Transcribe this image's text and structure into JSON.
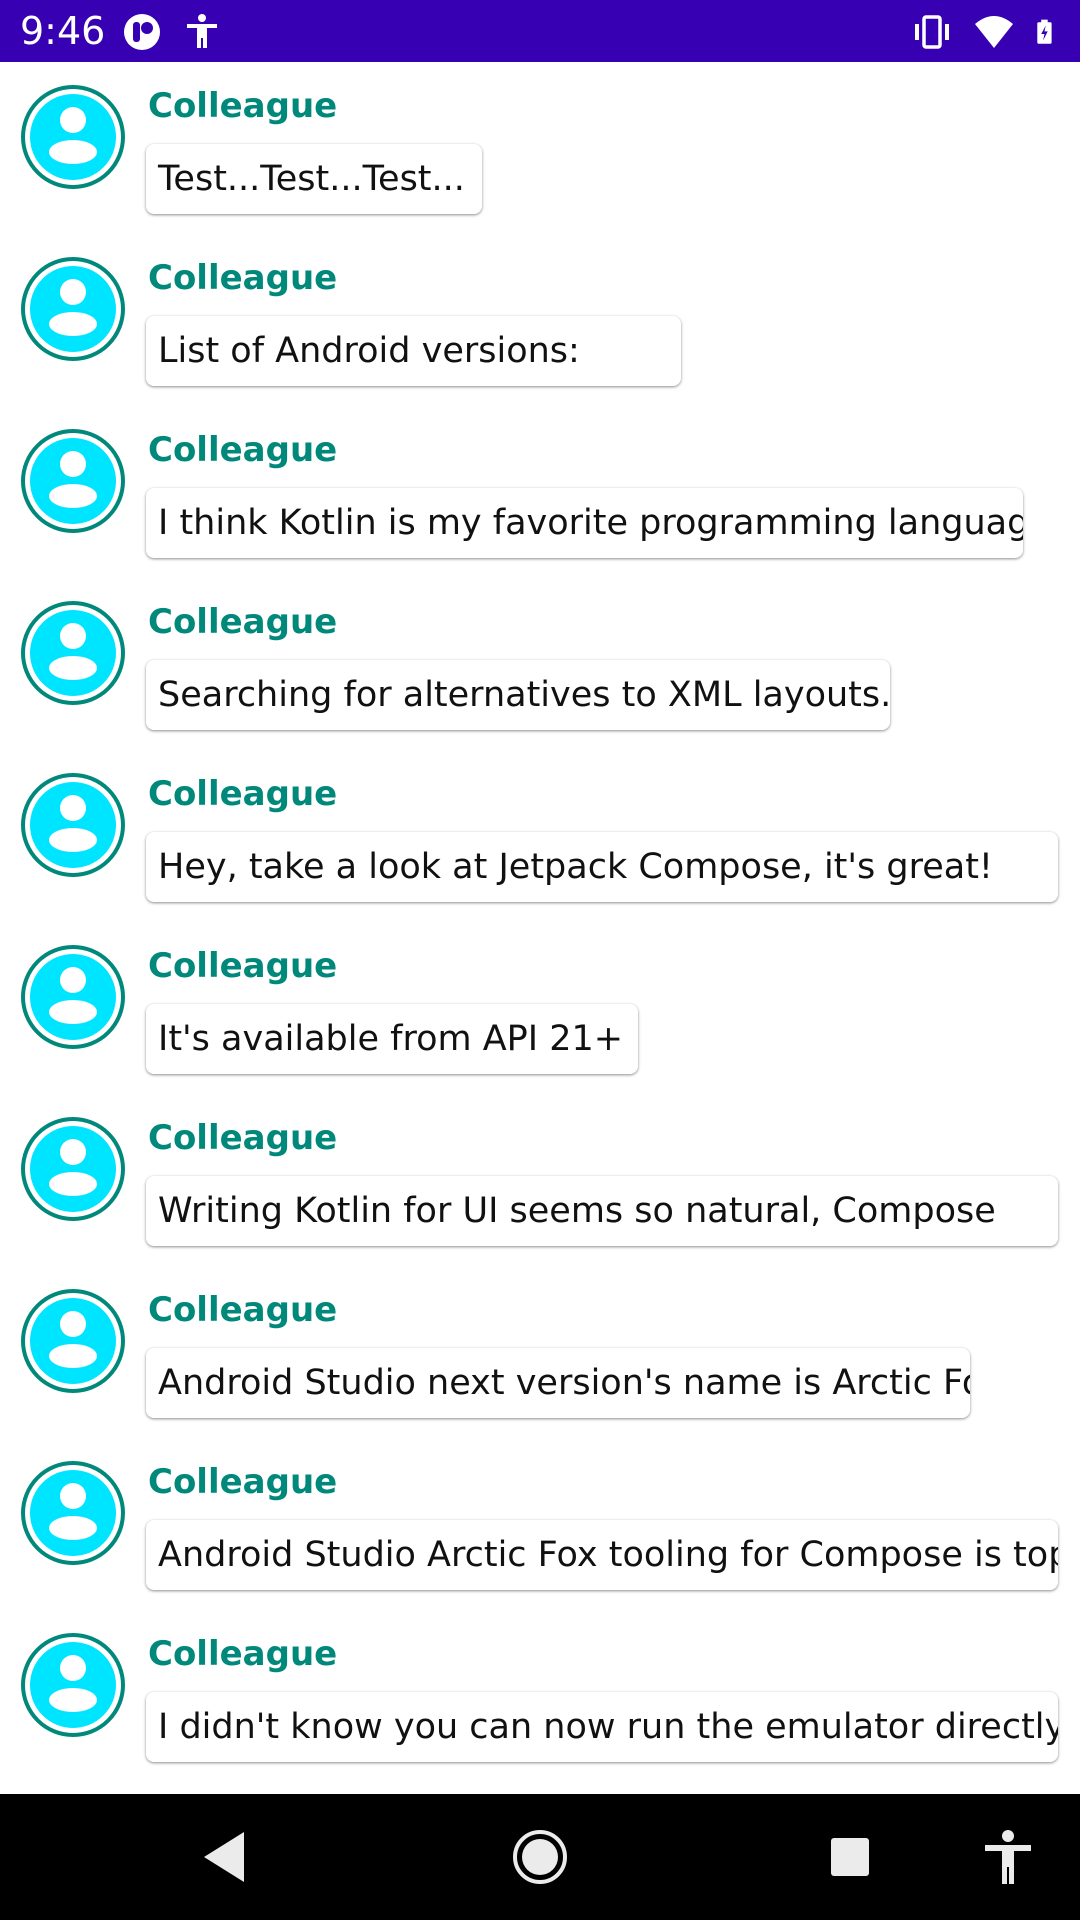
{
  "status_bar": {
    "time": "9:46",
    "left_icons": [
      "notification-app-icon",
      "accessibility-icon"
    ],
    "right_icons": [
      "vibrate-icon",
      "wifi-icon",
      "battery-charging-icon"
    ],
    "background": "#3700b3"
  },
  "colors": {
    "sender_name": "#00897b",
    "avatar": "#00e5ff",
    "avatar_ring": "#00897b"
  },
  "messages": [
    {
      "sender": "Colleague",
      "text": "Test...Test...Test..."
    },
    {
      "sender": "Colleague",
      "text": "List of Android versions:"
    },
    {
      "sender": "Colleague",
      "text": "I think Kotlin is my favorite programming language."
    },
    {
      "sender": "Colleague",
      "text": "Searching for alternatives to XML layouts..."
    },
    {
      "sender": "Colleague",
      "text": "Hey, take a look at Jetpack Compose, it's great!"
    },
    {
      "sender": "Colleague",
      "text": "It's available from API 21+ :)"
    },
    {
      "sender": "Colleague",
      "text": "Writing Kotlin for UI seems so natural, Compose"
    },
    {
      "sender": "Colleague",
      "text": "Android Studio next version's name is Arctic Fox"
    },
    {
      "sender": "Colleague",
      "text": "Android Studio Arctic Fox tooling for Compose is top"
    },
    {
      "sender": "Colleague",
      "text": "I didn't know you can now run the emulator directly"
    }
  ],
  "nav_bar": {
    "buttons": [
      "back-icon",
      "home-icon",
      "recents-icon",
      "accessibility-icon"
    ]
  }
}
